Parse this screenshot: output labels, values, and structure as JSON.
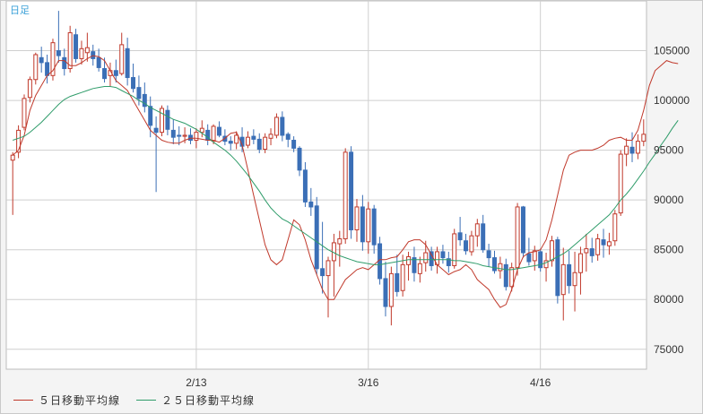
{
  "chart_data": {
    "type": "candlestick",
    "period_label": "日足",
    "ylim": [
      73000,
      110000
    ],
    "y_ticks": [
      75000,
      80000,
      85000,
      90000,
      95000,
      100000,
      105000
    ],
    "y_tick_labels": [
      "75000",
      "80000",
      "85000",
      "90000",
      "95000",
      "100000",
      "105000"
    ],
    "x_ticks": [
      {
        "index": 32,
        "label": "2/13"
      },
      {
        "index": 62,
        "label": "3/16"
      },
      {
        "index": 92,
        "label": "4/16"
      }
    ],
    "colors": {
      "up": "#c0392b",
      "down": "#3b6fb6",
      "ma5": "#c0392b",
      "ma25": "#2f9c6a",
      "grid": "#cfcfcf",
      "plot_bg": "#ffffff"
    },
    "series": [
      {
        "name": "５日移動平均線",
        "values": [
          94500,
          95000,
          96500,
          99000,
          100500,
          101500,
          102500,
          103000,
          104000,
          104000,
          103500,
          103500,
          103800,
          104200,
          104500,
          104400,
          104000,
          103000,
          102000,
          101500,
          101000,
          100000,
          99000,
          98000,
          97000,
          96500,
          96000,
          95800,
          95700,
          95700,
          96000,
          96200,
          96200,
          96100,
          96000,
          96000,
          95800,
          96200,
          96700,
          96800,
          95500,
          93000,
          90500,
          88000,
          85500,
          84000,
          83500,
          84000,
          86000,
          88000,
          87500,
          86000,
          84000,
          82500,
          81000,
          80000,
          80000,
          81000,
          82000,
          82500,
          83000,
          83200,
          83000,
          83500,
          84000,
          84000,
          84200,
          84300,
          85000,
          85800,
          86000,
          86000,
          85500,
          84500,
          83500,
          83000,
          82500,
          82800,
          83000,
          83500,
          83000,
          82000,
          81500,
          81000,
          80000,
          79200,
          79500,
          81000,
          83000,
          84300,
          84700,
          84800,
          85000,
          86000,
          88000,
          90500,
          93000,
          94500,
          94800,
          95000,
          95000,
          95000,
          95200,
          95500,
          96000,
          96200,
          96300,
          96000,
          96000,
          97000,
          99000,
          101500,
          103000,
          103500,
          104000,
          103800,
          103700
        ]
      },
      {
        "name": "２５日移動平均線",
        "values": [
          96000,
          96200,
          96400,
          96800,
          97300,
          97800,
          98400,
          99000,
          99600,
          100100,
          100400,
          100600,
          100800,
          101000,
          101200,
          101300,
          101400,
          101400,
          101300,
          101000,
          100700,
          100400,
          100000,
          99700,
          99300,
          99000,
          98700,
          98400,
          98100,
          97900,
          97700,
          97400,
          97100,
          96700,
          96300,
          95800,
          95400,
          95000,
          94500,
          93900,
          93200,
          92500,
          91700,
          90900,
          90000,
          89200,
          88600,
          88100,
          87800,
          87400,
          87000,
          86600,
          86200,
          85800,
          85400,
          85000,
          84700,
          84400,
          84200,
          84000,
          83800,
          83700,
          83600,
          83500,
          83500,
          83600,
          83700,
          83800,
          83900,
          84000,
          84000,
          84000,
          84000,
          84000,
          84000,
          84000,
          84000,
          83900,
          83900,
          83800,
          83700,
          83600,
          83400,
          83300,
          83200,
          83100,
          83000,
          83000,
          83100,
          83200,
          83300,
          83400,
          83500,
          83700,
          84000,
          84300,
          84600,
          85000,
          85500,
          86000,
          86500,
          87000,
          87500,
          88000,
          88500,
          89200,
          90000,
          90600,
          91300,
          92100,
          92900,
          93800,
          94600,
          95500,
          96300,
          97200,
          98000
        ]
      }
    ],
    "candles": [
      [
        94000,
        94800,
        88500,
        94500
      ],
      [
        94800,
        97500,
        94200,
        97000
      ],
      [
        97300,
        100600,
        97000,
        100200
      ],
      [
        100300,
        102400,
        99800,
        102100
      ],
      [
        102100,
        104800,
        101600,
        104600
      ],
      [
        104300,
        105400,
        102800,
        103800
      ],
      [
        103800,
        104600,
        101700,
        102500
      ],
      [
        102500,
        106200,
        102000,
        105800
      ],
      [
        105000,
        109000,
        103800,
        104500
      ],
      [
        104300,
        105200,
        102500,
        103200
      ],
      [
        103200,
        107500,
        102800,
        106800
      ],
      [
        106600,
        107200,
        103800,
        104200
      ],
      [
        104200,
        106000,
        103600,
        105200
      ],
      [
        104800,
        106800,
        103900,
        105300
      ],
      [
        104900,
        105600,
        103500,
        104200
      ],
      [
        104300,
        105200,
        102900,
        103300
      ],
      [
        103200,
        104300,
        101800,
        102200
      ],
      [
        102500,
        103800,
        101400,
        103000
      ],
      [
        103000,
        104100,
        101800,
        102500
      ],
      [
        102700,
        106800,
        102500,
        105600
      ],
      [
        105200,
        106300,
        101500,
        102300
      ],
      [
        102300,
        103700,
        100800,
        101200
      ],
      [
        101300,
        102500,
        99500,
        100200
      ],
      [
        100600,
        101800,
        98800,
        99400
      ],
      [
        99400,
        100400,
        96300,
        97500
      ],
      [
        97200,
        98400,
        90800,
        96800
      ],
      [
        96800,
        99500,
        96400,
        99200
      ],
      [
        99000,
        99500,
        96500,
        97100
      ],
      [
        97000,
        98100,
        95600,
        96300
      ],
      [
        96500,
        97400,
        95500,
        96400
      ],
      [
        96400,
        97300,
        95700,
        96500
      ],
      [
        96500,
        97200,
        95600,
        96000
      ],
      [
        96000,
        97200,
        95200,
        96800
      ],
      [
        96800,
        98000,
        96300,
        97200
      ],
      [
        97000,
        97600,
        95500,
        96000
      ],
      [
        95900,
        97600,
        95600,
        97400
      ],
      [
        97300,
        97900,
        96300,
        96500
      ],
      [
        96400,
        97100,
        95500,
        95900
      ],
      [
        95900,
        96400,
        95000,
        95700
      ],
      [
        95700,
        96900,
        95100,
        96500
      ],
      [
        96300,
        97300,
        94800,
        95400
      ],
      [
        95500,
        96900,
        95200,
        96300
      ],
      [
        96400,
        97100,
        95600,
        96100
      ],
      [
        96100,
        96700,
        94700,
        95100
      ],
      [
        95100,
        96700,
        94700,
        96300
      ],
      [
        96200,
        97200,
        95500,
        96600
      ],
      [
        96500,
        98700,
        96200,
        98300
      ],
      [
        98300,
        98900,
        95900,
        96500
      ],
      [
        96600,
        96800,
        95300,
        96100
      ],
      [
        96000,
        96400,
        94800,
        95200
      ],
      [
        95200,
        95400,
        92400,
        93000
      ],
      [
        93000,
        93800,
        89300,
        89800
      ],
      [
        89800,
        91200,
        88400,
        89300
      ],
      [
        89400,
        90300,
        82500,
        83100
      ],
      [
        83100,
        87800,
        80600,
        82400
      ],
      [
        82400,
        84300,
        78200,
        83900
      ],
      [
        83900,
        86600,
        80300,
        85700
      ],
      [
        85600,
        86900,
        83300,
        86100
      ],
      [
        86100,
        95200,
        85600,
        94800
      ],
      [
        94800,
        95400,
        86100,
        87000
      ],
      [
        87000,
        90100,
        85800,
        89300
      ],
      [
        89300,
        90500,
        84900,
        85800
      ],
      [
        85800,
        89800,
        84600,
        89100
      ],
      [
        89100,
        89500,
        84600,
        85500
      ],
      [
        85600,
        86300,
        81500,
        82100
      ],
      [
        82100,
        83800,
        78300,
        79300
      ],
      [
        79300,
        83300,
        77400,
        82600
      ],
      [
        82600,
        84500,
        80300,
        80800
      ],
      [
        80900,
        84500,
        80300,
        83500
      ],
      [
        83500,
        84800,
        81900,
        84300
      ],
      [
        84200,
        85300,
        81800,
        82700
      ],
      [
        82600,
        84300,
        81700,
        83600
      ],
      [
        83700,
        85900,
        82800,
        84700
      ],
      [
        84800,
        85300,
        82900,
        83400
      ],
      [
        83500,
        85300,
        82600,
        84800
      ],
      [
        84800,
        85500,
        83600,
        84200
      ],
      [
        84100,
        84800,
        82700,
        83400
      ],
      [
        83400,
        87100,
        83100,
        86600
      ],
      [
        86700,
        88300,
        85400,
        86000
      ],
      [
        85900,
        86600,
        84500,
        84900
      ],
      [
        84800,
        86900,
        84400,
        86400
      ],
      [
        86400,
        88100,
        85300,
        87600
      ],
      [
        87600,
        88500,
        84700,
        85000
      ],
      [
        84900,
        85600,
        83300,
        84200
      ],
      [
        84200,
        84900,
        82600,
        82900
      ],
      [
        82900,
        84300,
        82100,
        83600
      ],
      [
        83500,
        84100,
        80900,
        81300
      ],
      [
        81300,
        83700,
        80800,
        83200
      ],
      [
        83200,
        89700,
        82400,
        89300
      ],
      [
        89300,
        89400,
        84200,
        84700
      ],
      [
        84600,
        86200,
        83400,
        83800
      ],
      [
        83900,
        85400,
        82900,
        84900
      ],
      [
        84800,
        85100,
        82800,
        83200
      ],
      [
        83200,
        84700,
        81800,
        83900
      ],
      [
        83900,
        86400,
        83300,
        85900
      ],
      [
        86000,
        86300,
        79600,
        80400
      ],
      [
        80500,
        85200,
        77900,
        83500
      ],
      [
        83500,
        84900,
        80600,
        81400
      ],
      [
        81400,
        84800,
        78800,
        82700
      ],
      [
        82700,
        85300,
        80500,
        84600
      ],
      [
        84700,
        86600,
        82800,
        85100
      ],
      [
        85100,
        86200,
        83700,
        84400
      ],
      [
        84500,
        86600,
        83900,
        86100
      ],
      [
        86000,
        87100,
        84200,
        85500
      ],
      [
        85400,
        86700,
        84500,
        85800
      ],
      [
        85900,
        89000,
        85400,
        88600
      ],
      [
        88700,
        95000,
        88400,
        94600
      ],
      [
        94600,
        96200,
        93400,
        95400
      ],
      [
        95300,
        96800,
        93800,
        94700
      ],
      [
        94700,
        96600,
        94100,
        95900
      ],
      [
        95900,
        98100,
        95400,
        96600
      ]
    ]
  }
}
